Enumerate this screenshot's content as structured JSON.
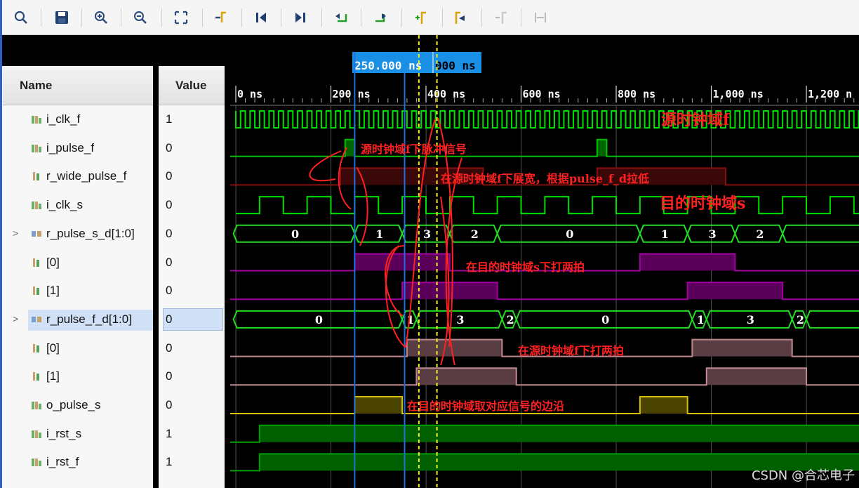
{
  "toolbar": {
    "buttons": [
      "search-icon",
      "save-icon",
      "zoom-in-icon",
      "zoom-out-icon",
      "zoom-fit-icon",
      "go-to-cursor-icon",
      "go-to-start-icon",
      "go-to-end-icon",
      "previous-transition-icon",
      "next-transition-icon",
      "add-marker-icon",
      "previous-marker-icon",
      "next-marker-icon",
      "swap-cursors-icon"
    ]
  },
  "columns": {
    "name": "Name",
    "value": "Value"
  },
  "signals": [
    {
      "name": "i_clk_f",
      "value": "1",
      "icon": "wire-icon"
    },
    {
      "name": "i_pulse_f",
      "value": "0",
      "icon": "wire-icon"
    },
    {
      "name": "r_wide_pulse_f",
      "value": "0",
      "icon": "register-icon"
    },
    {
      "name": "i_clk_s",
      "value": "0",
      "icon": "wire-icon"
    },
    {
      "name": "r_pulse_s_d[1:0]",
      "value": "0",
      "icon": "bus-icon",
      "expandable": true
    },
    {
      "name": "[0]",
      "value": "0",
      "icon": "register-icon"
    },
    {
      "name": "[1]",
      "value": "0",
      "icon": "register-icon"
    },
    {
      "name": "r_pulse_f_d[1:0]",
      "value": "0",
      "icon": "bus-icon",
      "expandable": true,
      "selected": true
    },
    {
      "name": "[0]",
      "value": "0",
      "icon": "register-icon"
    },
    {
      "name": "[1]",
      "value": "0",
      "icon": "register-icon"
    },
    {
      "name": "o_pulse_s",
      "value": "0",
      "icon": "wire-icon"
    },
    {
      "name": "i_rst_s",
      "value": "1",
      "icon": "wire-icon"
    },
    {
      "name": "i_rst_f",
      "value": "1",
      "icon": "wire-icon"
    }
  ],
  "cursor": {
    "label": "250.000 ns",
    "second_label": "000 ns"
  },
  "timeline": [
    "0 ns",
    "200 ns",
    "400 ns",
    "600 ns",
    "800 ns",
    "1,000 ns",
    "1,200 n"
  ],
  "buses": {
    "r_pulse_s_d": [
      "0",
      "1",
      "3",
      "2",
      "0",
      "1",
      "3",
      "2"
    ],
    "r_pulse_f_d": [
      "0",
      "1",
      "3",
      "2",
      "0",
      "1",
      "3",
      "2"
    ]
  },
  "annotations": [
    "源时钟域f",
    "源时钟域f下脉冲信号",
    "在源时钟域f下展宽，根据pulse_f_d拉低",
    "目的时钟域s",
    "在目的时钟域s下打两拍",
    "在源时钟域f下打两拍",
    "在目的时钟域取对应信号的边沿"
  ],
  "watermark": "CSDN @合芯电子",
  "colors": {
    "green": "#00e000",
    "bus_green": "#22dd22",
    "purple": "#a000a0",
    "pink_fill": "#5a3d42",
    "olive": "#4a4400",
    "red_wave": "#8a1010",
    "annotation": "#ff2020",
    "cursor_blue": "#1e6fe0",
    "marker_yellow": "#f2ef2a"
  }
}
